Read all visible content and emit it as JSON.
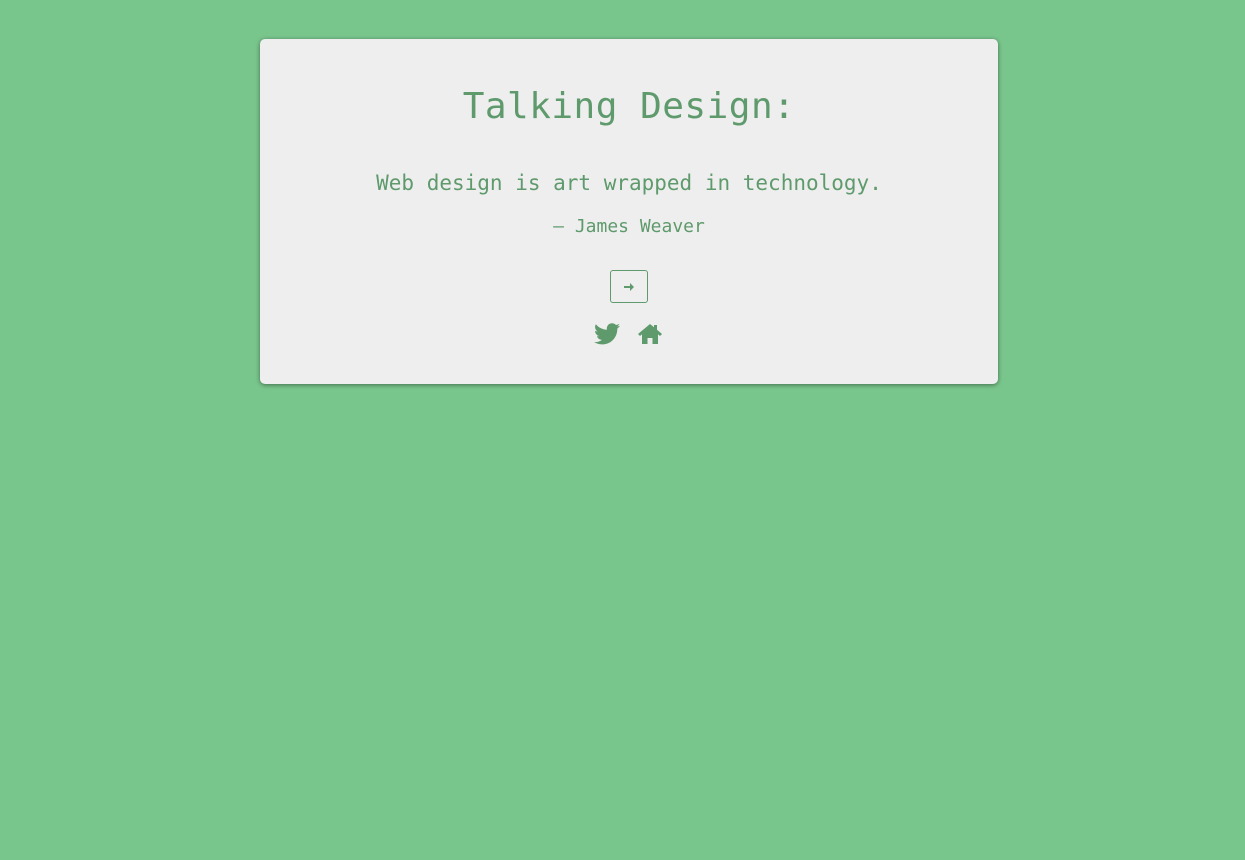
{
  "card": {
    "title": "Talking Design:",
    "quote": "Web design is art wrapped in technology.",
    "author": "– James Weaver"
  },
  "controls": {
    "next_icon": "arrow-right-icon",
    "social_icons": [
      "twitter-icon",
      "home-icon"
    ]
  },
  "colors": {
    "background": "#79c68c",
    "card": "#eeeeee",
    "accent": "#5e9a6c"
  }
}
